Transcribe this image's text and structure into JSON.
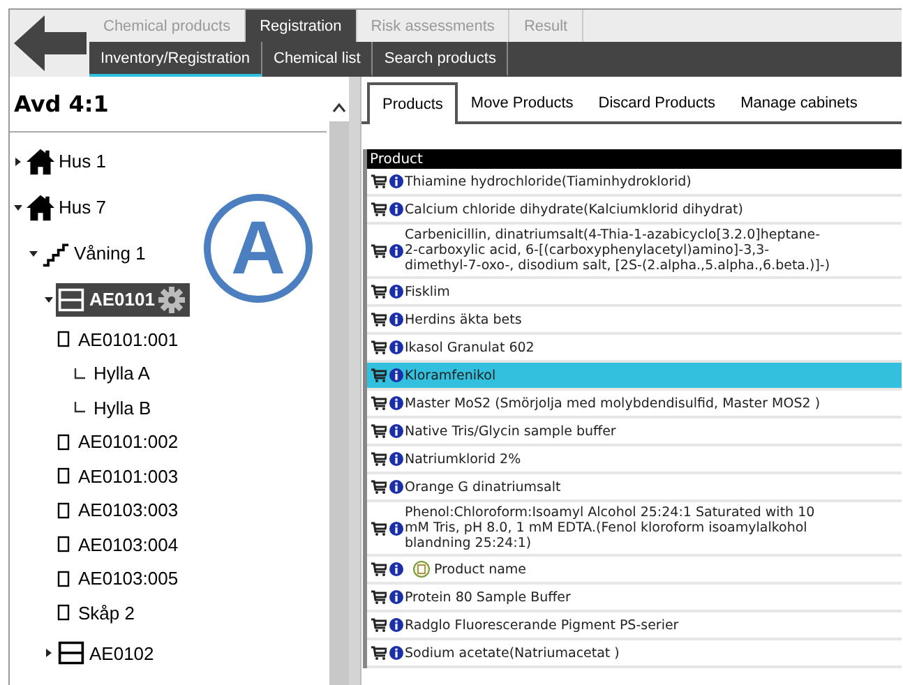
{
  "main_tabs": [
    {
      "label": "Chemical products",
      "selected": false
    },
    {
      "label": "Registration",
      "selected": true
    },
    {
      "label": "Risk assessments",
      "selected": false
    },
    {
      "label": "Result",
      "selected": false
    }
  ],
  "sub_tabs": [
    {
      "label": "Inventory/Registration",
      "selected": true
    },
    {
      "label": "Chemical list",
      "selected": false
    },
    {
      "label": "Search products",
      "selected": false
    }
  ],
  "sidebar": {
    "title": "Avd 4:1",
    "annotation": "A",
    "tree": [
      {
        "kind": "house",
        "label": "Hus 1",
        "expanded": false,
        "selected": false
      },
      {
        "kind": "house",
        "label": "Hus 7",
        "expanded": true,
        "selected": false,
        "children": [
          {
            "kind": "floor",
            "label": "Våning 1",
            "expanded": true,
            "selected": false,
            "children": [
              {
                "kind": "cabinet",
                "label": "AE0101",
                "expanded": true,
                "selected": true,
                "children": [
                  {
                    "kind": "shelf",
                    "label": "AE0101:001",
                    "selected": false,
                    "children": [
                      {
                        "kind": "subshelf",
                        "label": "Hylla A",
                        "selected": false
                      },
                      {
                        "kind": "subshelf",
                        "label": "Hylla B",
                        "selected": false
                      }
                    ]
                  },
                  {
                    "kind": "shelf",
                    "label": "AE0101:002",
                    "selected": false
                  },
                  {
                    "kind": "shelf",
                    "label": "AE0101:003",
                    "selected": false
                  },
                  {
                    "kind": "shelf",
                    "label": "AE0103:003",
                    "selected": false
                  },
                  {
                    "kind": "shelf",
                    "label": "AE0103:004",
                    "selected": false
                  },
                  {
                    "kind": "shelf",
                    "label": "AE0103:005",
                    "selected": false
                  },
                  {
                    "kind": "shelf",
                    "label": "Skåp 2",
                    "selected": false
                  }
                ]
              },
              {
                "kind": "cabinet",
                "label": "AE0102",
                "expanded": false,
                "selected": false
              }
            ]
          }
        ]
      }
    ]
  },
  "content_tabs": [
    {
      "label": "Products",
      "selected": true
    },
    {
      "label": "Move Products",
      "selected": false
    },
    {
      "label": "Discard Products",
      "selected": false
    },
    {
      "label": "Manage cabinets",
      "selected": false
    }
  ],
  "table": {
    "columns": [
      "Product"
    ],
    "rows": [
      {
        "kind": "plain",
        "name": "Thiamine hydrochloride(Tiaminhydroklorid)",
        "selected": false
      },
      {
        "kind": "plain",
        "name": "Calcium chloride dihydrate(Kalciumklorid dihydrat)",
        "selected": false
      },
      {
        "kind": "plain",
        "name": "Carbenicillin, dinatriumsalt(4-Thia-1-azabicyclo[3.2.0]heptane-2-carboxylic acid, 6-[(carboxyphenylacetyl)amino]-3,3-dimethyl-7-oxo-, disodium salt, [2S-(2.alpha.,5.alpha.,6.beta.)]-)",
        "selected": false
      },
      {
        "kind": "plain",
        "name": "Fisklim",
        "selected": false
      },
      {
        "kind": "plain",
        "name": "Herdins äkta bets",
        "selected": false
      },
      {
        "kind": "plain",
        "name": "Ikasol Granulat 602",
        "selected": false
      },
      {
        "kind": "plain",
        "name": "Kloramfenikol",
        "selected": true
      },
      {
        "kind": "plain",
        "name": "Master MoS2 (Smörjolja med molybdendisulfid, Master MOS2 )",
        "selected": false
      },
      {
        "kind": "plain",
        "name": "Native Tris/Glycin sample buffer",
        "selected": false
      },
      {
        "kind": "plain",
        "name": "Natriumklorid 2%",
        "selected": false
      },
      {
        "kind": "plain",
        "name": "Orange G dinatriumsalt",
        "selected": false
      },
      {
        "kind": "plain",
        "name": "Phenol:Chloroform:Isoamyl Alcohol 25:24:1 Saturated with 10 mM Tris, pH 8.0, 1 mM EDTA.(Fenol kloroform isoamylalkohol blandning 25:24:1)",
        "selected": false
      },
      {
        "kind": "note",
        "name": "Product name",
        "selected": false
      },
      {
        "kind": "plain",
        "name": "Protein 80 Sample Buffer",
        "selected": false
      },
      {
        "kind": "plain",
        "name": "Radglo Fluorescerande Pigment PS-serier",
        "selected": false
      },
      {
        "kind": "plain",
        "name": "Sodium acetate(Natriumacetat )",
        "selected": false
      }
    ]
  }
}
